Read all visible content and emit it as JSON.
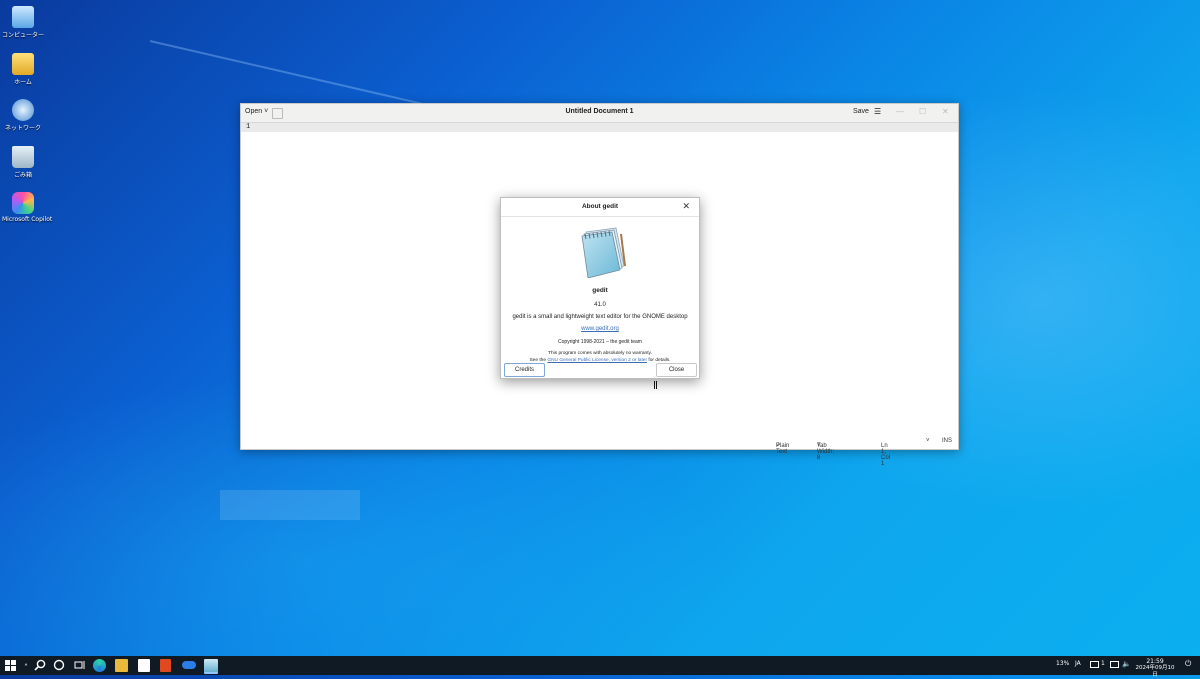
{
  "desktop": {
    "icons": [
      {
        "label": "コンピューター"
      },
      {
        "label": "ホーム"
      },
      {
        "label": "ネットワーク"
      },
      {
        "label": "ごみ箱"
      },
      {
        "label": "Microsoft Copilot"
      }
    ]
  },
  "gedit": {
    "open_label": "Open",
    "open_chevron": "˅",
    "title": "Untitled Document 1",
    "save_label": "Save",
    "menu_icon": "☰",
    "minimize_icon": "—",
    "maximize_icon": "☐",
    "close_icon": "✕",
    "line_number": "1",
    "status": {
      "language": "Plain Text",
      "tab_width": "Tab Width: 8",
      "cursor": "Ln 1, Col 1",
      "mode": "INS",
      "chevron": "˅"
    }
  },
  "about_dialog": {
    "title": "About gedit",
    "close_icon": "✕",
    "app_name": "gedit",
    "version": "41.0",
    "description": "gedit is a small and lightweight text editor for the GNOME desktop",
    "website": "www.gedit.org",
    "copyright": "Copyright 1998-2021 – the gedit team",
    "warranty_line1": "This program comes with absolutely no warranty.",
    "warranty_prefix": "See the",
    "license_link": "GNU General Public License, version 2 or later",
    "warranty_suffix": "for details.",
    "credits_label": "Credits",
    "close_label": "Close"
  },
  "taskbar": {
    "start_icon": "windows-start-icon",
    "search_icon": "search-icon",
    "tray": {
      "battery": "13%",
      "ime": "JA",
      "chevron": "˄",
      "notification_count": "1"
    },
    "clock": {
      "time": "21:59",
      "date": "2024年09月10日"
    }
  },
  "colors": {
    "desktop_accent": "#0a86e6",
    "taskbar": "#101a24",
    "link": "#3d6fb6"
  }
}
